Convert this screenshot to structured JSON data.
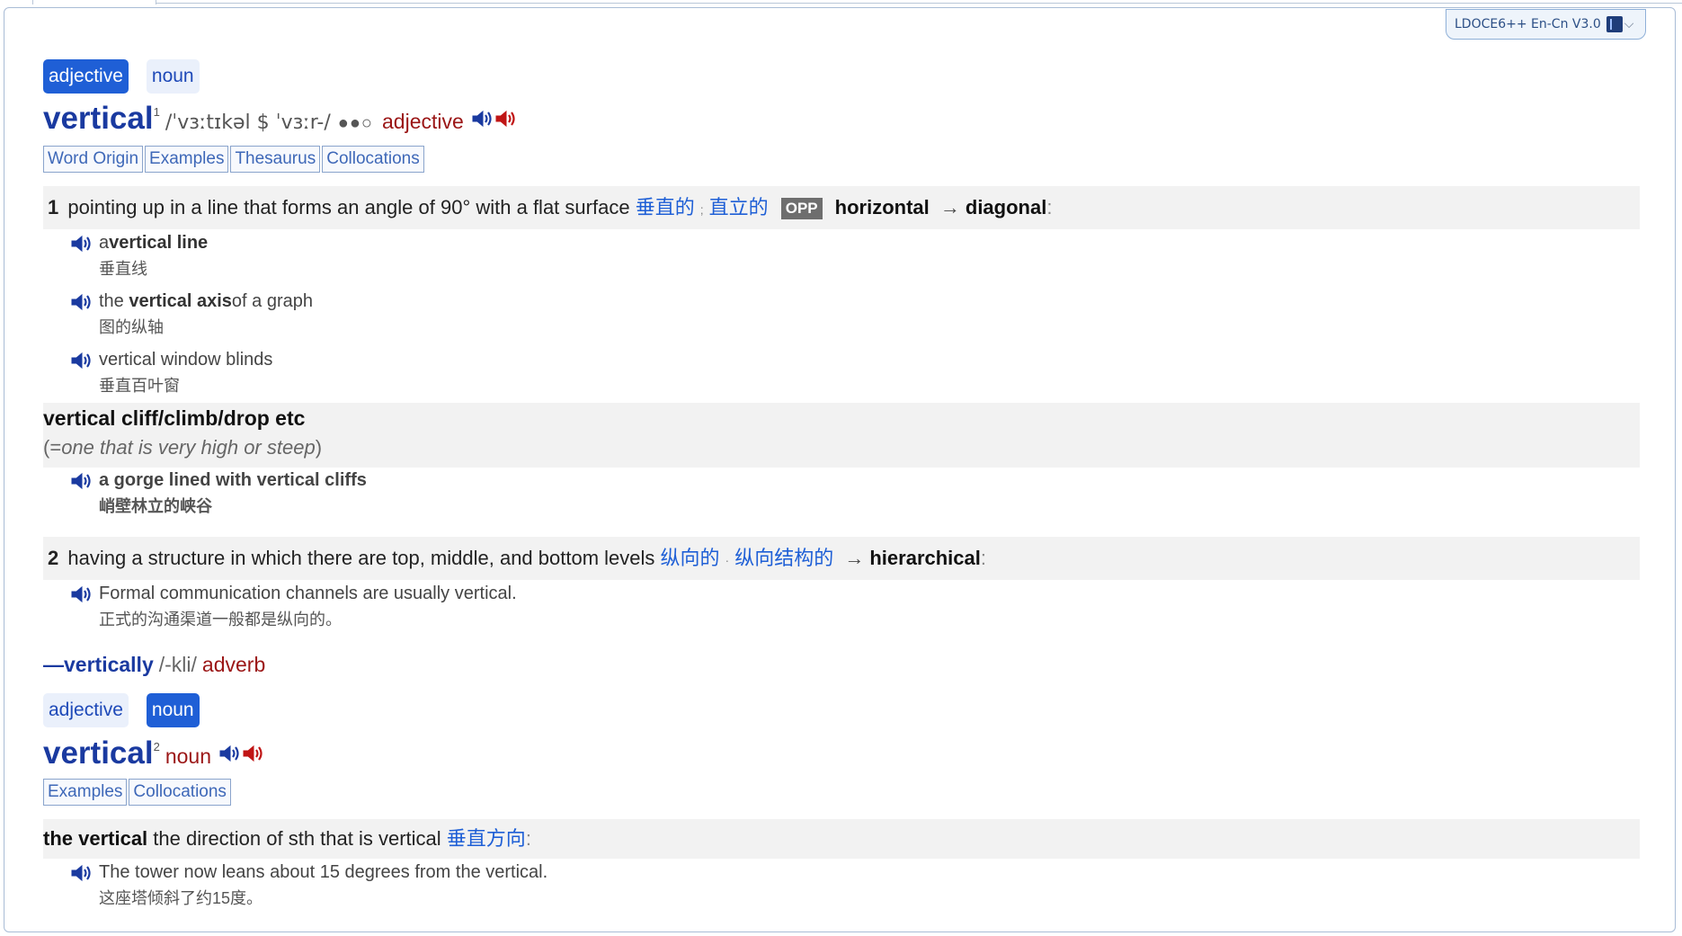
{
  "dictionary_selector": {
    "label": "LDOCE6++ En-Cn V3.0"
  },
  "entries": [
    {
      "pos_tabs": [
        "adjective",
        "noun"
      ],
      "active_tab": 0,
      "headword": "vertical",
      "homnum": "1",
      "pronunciation": "/ˈvɜːtɪkəl $ ˈvɜːr-/",
      "frequency": "●●○",
      "pos": "adjective",
      "links": [
        "Word Origin",
        "Examples",
        "Thesaurus",
        "Collocations"
      ],
      "senses": [
        {
          "num": "1",
          "definition": "pointing up in a line that forms an angle of 90° with a flat surface",
          "translation_1": "垂直的",
          "separator": ";",
          "translation_2": "直立的",
          "opp_label": "OPP",
          "opp_word": "horizontal",
          "arrow": "→",
          "related": "diagonal",
          "colon": ":",
          "examples": [
            {
              "pre": "a ",
              "bold": "vertical line",
              "post": "",
              "cn": "垂直线"
            },
            {
              "pre": "the ",
              "bold": "vertical axis",
              "post": " of a graph",
              "cn": "图的纵轴"
            },
            {
              "pre": "vertical window blinds",
              "bold": "",
              "post": "",
              "cn": "垂直百叶窗"
            }
          ],
          "collocation": {
            "head": "vertical cliff/climb/drop etc",
            "gloss_open": "(=",
            "gloss": "one that is very high or steep",
            "gloss_close": ")",
            "example": {
              "en": "a gorge lined with vertical cliffs",
              "cn": "峭壁林立的峡谷"
            }
          }
        },
        {
          "num": "2",
          "definition": "having a structure in which there are top, middle, and bottom levels",
          "translation_1": "纵向的",
          "separator": "·",
          "translation_2": "纵向结构的",
          "arrow": "→",
          "related": "hierarchical",
          "colon": ":",
          "examples": [
            {
              "en": "Formal communication channels are usually vertical.",
              "cn": "正式的沟通渠道一般都是纵向的。"
            }
          ]
        }
      ],
      "derived": {
        "word": "—vertically",
        "pron": "/-kli/",
        "pos": "adverb"
      }
    },
    {
      "pos_tabs": [
        "adjective",
        "noun"
      ],
      "active_tab": 1,
      "headword": "vertical",
      "homnum": "2",
      "pos": "noun",
      "links": [
        "Examples",
        "Collocations"
      ],
      "senses": [
        {
          "lexunit": "the vertical",
          "definition": "the direction of sth that is vertical",
          "translation_1": "垂直方向",
          "colon": ":",
          "examples": [
            {
              "en": "The tower now leans about 15 degrees from the vertical.",
              "cn": "这座塔倾斜了约15度。"
            }
          ]
        }
      ]
    }
  ],
  "icons": {
    "speaker_uk": "speaker-icon (dark blue)",
    "speaker_us": "speaker-icon (red)",
    "example_audio": "speaker-icon",
    "dropdown": "chevron-down-icon",
    "dictionary": "book-icon"
  },
  "colors": {
    "headword": "#1a3aa0",
    "pos": "#9b1616",
    "translation": "#1e5fd6",
    "active_tab": "#1f5fd6",
    "sense_bg": "#f2f2f2"
  }
}
